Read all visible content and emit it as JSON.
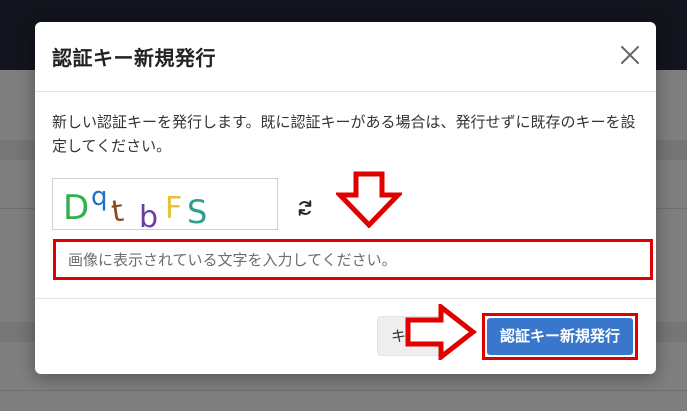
{
  "dialog": {
    "title": "認証キー新規発行",
    "description": "新しい認証キーを発行します。既に認証キーがある場合は、発行せずに既存のキーを設定してください。",
    "captcha": {
      "text": "DqtbFS",
      "chars": [
        {
          "ch": "D",
          "color": "#2fb14b"
        },
        {
          "ch": "q",
          "color": "#1a73c7"
        },
        {
          "ch": "t",
          "color": "#8a4a1d"
        },
        {
          "ch": "b",
          "color": "#6a3fa0"
        },
        {
          "ch": "F",
          "color": "#e8c23a"
        },
        {
          "ch": "S",
          "color": "#2d9e8e"
        }
      ]
    },
    "input": {
      "placeholder": "画像に表示されている文字を入力してください。",
      "value": ""
    },
    "buttons": {
      "cancel_label": "キャンセル",
      "submit_label": "認証キー新規発行"
    }
  },
  "colors": {
    "primary": "#3877cc",
    "annotation_red": "#e00000",
    "overlay": "#808080",
    "topbar": "#12151d"
  },
  "icons": [
    "close-icon",
    "refresh-icon",
    "arrow-down-annotation",
    "arrow-right-annotation"
  ]
}
